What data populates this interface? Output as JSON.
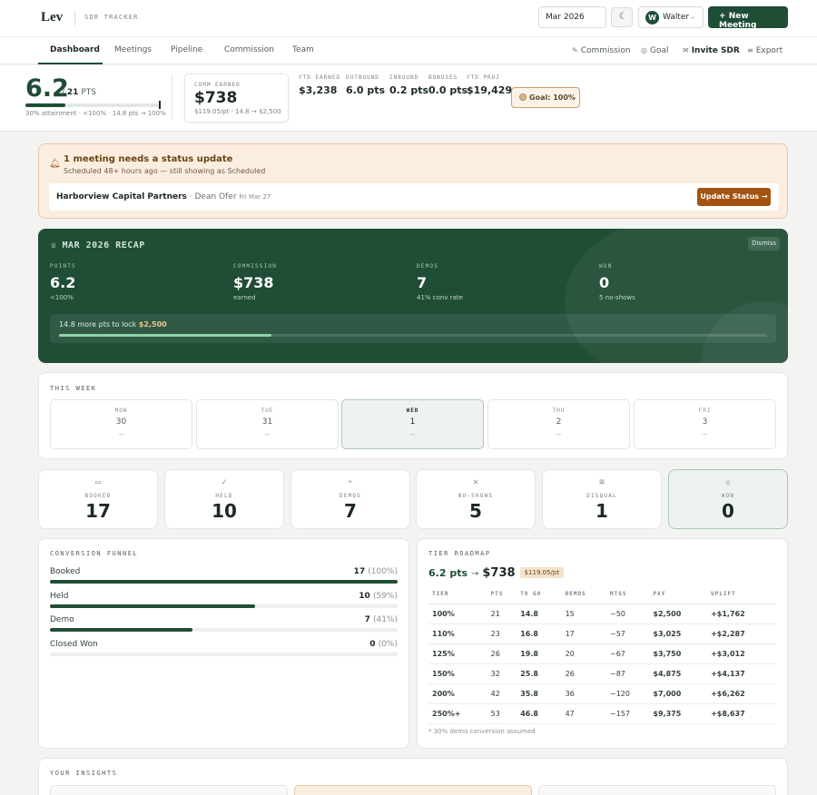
{
  "header": {
    "logo": "Lev",
    "app_name": "SDR TRACKER",
    "month": "Mar 2026",
    "user_initial": "W",
    "user_name": "Walter",
    "new_meeting_label": "New Meeting"
  },
  "tabs": [
    "Dashboard",
    "Meetings",
    "Pipeline",
    "Commission",
    "Team"
  ],
  "actions": {
    "commission": "Commission",
    "goal": "Goal",
    "invite": "Invite SDR",
    "export": "Export"
  },
  "stats": {
    "points": "6.2",
    "target": "21",
    "points_unit": "PTS",
    "attainment_fraction": 0.3,
    "attainment_text": "30% attainment · <100% · 14.8 pts → 100%",
    "comm_label": "COMM EARNED",
    "comm_value": "$738",
    "comm_sub": "$119.05/pt · 14.8 → $2,500",
    "kpis": [
      {
        "label": "YTD EARNED",
        "value": "$3,238"
      },
      {
        "label": "OUTBOUND",
        "value": "6.0 pts"
      },
      {
        "label": "INBOUND",
        "value": "0.2 pts"
      },
      {
        "label": "BONUSES",
        "value": "0.0 pts"
      },
      {
        "label": "YTD PROJ",
        "value": "$19,429"
      }
    ],
    "goal_label": "Goal: 100%"
  },
  "alert": {
    "title": "1 meeting needs a status update",
    "subtitle": "Scheduled 48+ hours ago — still showing as Scheduled",
    "company": "Harborview Capital Partners",
    "contact": "· Dean Ofer",
    "date": "Fri Mar 27",
    "button": "Update Status →"
  },
  "recap": {
    "title": "MAR 2026 RECAP",
    "dismiss": "Dismiss",
    "stats": [
      {
        "label": "POINTS",
        "value": "6.2",
        "sub": "<100%"
      },
      {
        "label": "COMMISSION",
        "value": "$738",
        "sub": "earned"
      },
      {
        "label": "DEMOS",
        "value": "7",
        "sub": "41% conv rate"
      },
      {
        "label": "WON",
        "value": "0",
        "sub": "5 no-shows"
      }
    ],
    "lock_prefix": "14.8 more pts to lock",
    "lock_amount": "$2,500",
    "lock_progress": 0.3
  },
  "week": {
    "label": "THIS WEEK",
    "days": [
      {
        "name": "MON",
        "num": "30",
        "value": "—"
      },
      {
        "name": "TUE",
        "num": "31",
        "value": "—"
      },
      {
        "name": "WED",
        "num": "1",
        "value": "—"
      },
      {
        "name": "THU",
        "num": "2",
        "value": "—"
      },
      {
        "name": "FRI",
        "num": "3",
        "value": "—"
      }
    ]
  },
  "tiles": [
    {
      "label": "BOOKED",
      "value": "17",
      "icon": "calendar-icon"
    },
    {
      "label": "HELD",
      "value": "10",
      "icon": "check-icon"
    },
    {
      "label": "DEMOS",
      "value": "7",
      "icon": "send-icon"
    },
    {
      "label": "NO-SHOWS",
      "value": "5",
      "icon": "x-icon"
    },
    {
      "label": "DISQUAL",
      "value": "1",
      "icon": "list-icon"
    },
    {
      "label": "WON",
      "value": "0",
      "icon": "trophy-icon"
    }
  ],
  "funnel": {
    "label": "CONVERSION FUNNEL",
    "rows": [
      {
        "name": "Booked",
        "count": "17",
        "pct": "(100%)",
        "fraction": 1.0
      },
      {
        "name": "Held",
        "count": "10",
        "pct": "(59%)",
        "fraction": 0.59
      },
      {
        "name": "Demo",
        "count": "7",
        "pct": "(41%)",
        "fraction": 0.41
      },
      {
        "name": "Closed Won",
        "count": "0",
        "pct": "(0%)",
        "fraction": 0.0
      }
    ]
  },
  "roadmap": {
    "label": "TIER ROADMAP",
    "pts": "6.2 pts",
    "money": "$738",
    "rate": "$119.05/pt",
    "headers": [
      "TIER",
      "PTS",
      "TO GO",
      "DEMOS",
      "MTGS",
      "PAY",
      "UPLIFT"
    ],
    "rows": [
      [
        "100%",
        "21",
        "14.8",
        "15",
        "~50",
        "$2,500",
        "+$1,762"
      ],
      [
        "110%",
        "23",
        "16.8",
        "17",
        "~57",
        "$3,025",
        "+$2,287"
      ],
      [
        "125%",
        "26",
        "19.8",
        "20",
        "~67",
        "$3,750",
        "+$3,012"
      ],
      [
        "150%",
        "32",
        "25.8",
        "26",
        "~87",
        "$4,875",
        "+$4,137"
      ],
      [
        "200%",
        "42",
        "35.8",
        "36",
        "~120",
        "$7,000",
        "+$6,262"
      ],
      [
        "250%+",
        "53",
        "46.8",
        "47",
        "~157",
        "$9,375",
        "+$8,637"
      ]
    ],
    "footnote": "* 30% demo conversion assumed"
  },
  "insights": {
    "label": "YOUR INSIGHTS"
  },
  "colors": {
    "brand": "#1f4d36",
    "alert_bg": "#fbeee0",
    "alert_button": "#a4520f"
  }
}
